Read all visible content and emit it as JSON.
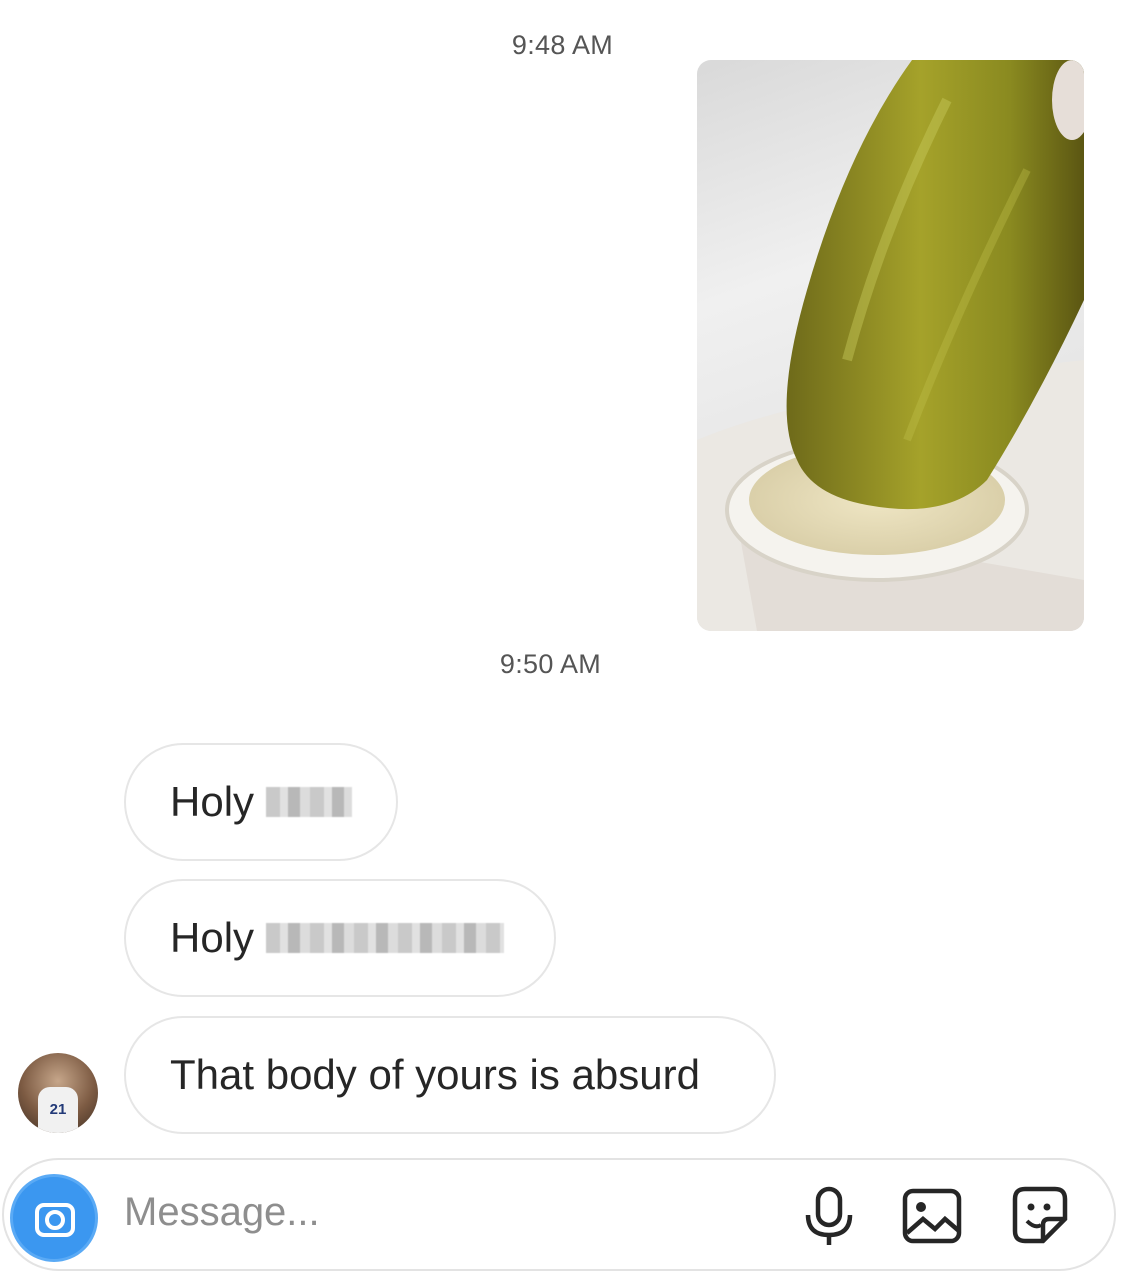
{
  "thread": {
    "timestamp_first": "9:48 AM",
    "timestamp_second": "9:50 AM",
    "messages": [
      {
        "prefix": "Holy",
        "censored": true
      },
      {
        "prefix": "Holy",
        "censored": true
      },
      {
        "text": "That body of yours is absurd"
      }
    ]
  },
  "composer": {
    "placeholder": "Message..."
  },
  "icons": {
    "camera": "camera-icon",
    "mic": "microphone-icon",
    "gallery": "image-icon",
    "sticker": "sticker-icon"
  },
  "colors": {
    "camera_button": "#3b97f0",
    "bubble_border": "#e6e6e6",
    "timestamp": "#555555",
    "placeholder": "#8e8e8e"
  }
}
